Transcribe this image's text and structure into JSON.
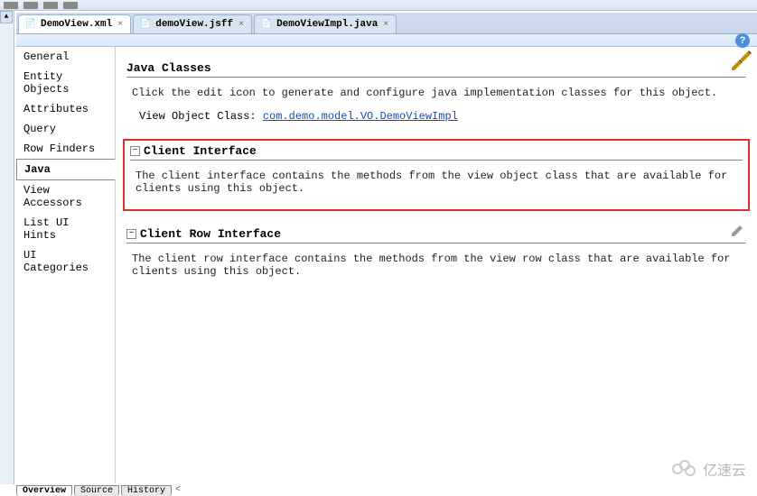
{
  "tabs": [
    {
      "label": "DemoView.xml",
      "active": true
    },
    {
      "label": "demoView.jsff",
      "active": false
    },
    {
      "label": "DemoViewImpl.java",
      "active": false
    }
  ],
  "sidebar": {
    "items": [
      "General",
      "Entity Objects",
      "Attributes",
      "Query",
      "Row Finders",
      "Java",
      "View Accessors",
      "List UI Hints",
      "UI Categories"
    ],
    "selected_index": 5
  },
  "sections": {
    "java_classes": {
      "title": "Java Classes",
      "desc": "Click the edit icon to generate and configure java implementation classes for this object.",
      "field_label": "View Object Class: ",
      "field_value": "com.demo.model.VO.DemoViewImpl"
    },
    "client_interface": {
      "title": "Client Interface",
      "desc": "The client interface contains the methods from the view object class that are available for clients using this object."
    },
    "client_row_interface": {
      "title": "Client Row Interface",
      "desc": "The client row interface contains the methods from the view row class that are available for clients using this object."
    }
  },
  "bottom_tabs": [
    "Overview",
    "Source",
    "History"
  ],
  "help_glyph": "?",
  "collapse_glyph": "–",
  "close_glyph": "×",
  "watermark": "亿速云"
}
